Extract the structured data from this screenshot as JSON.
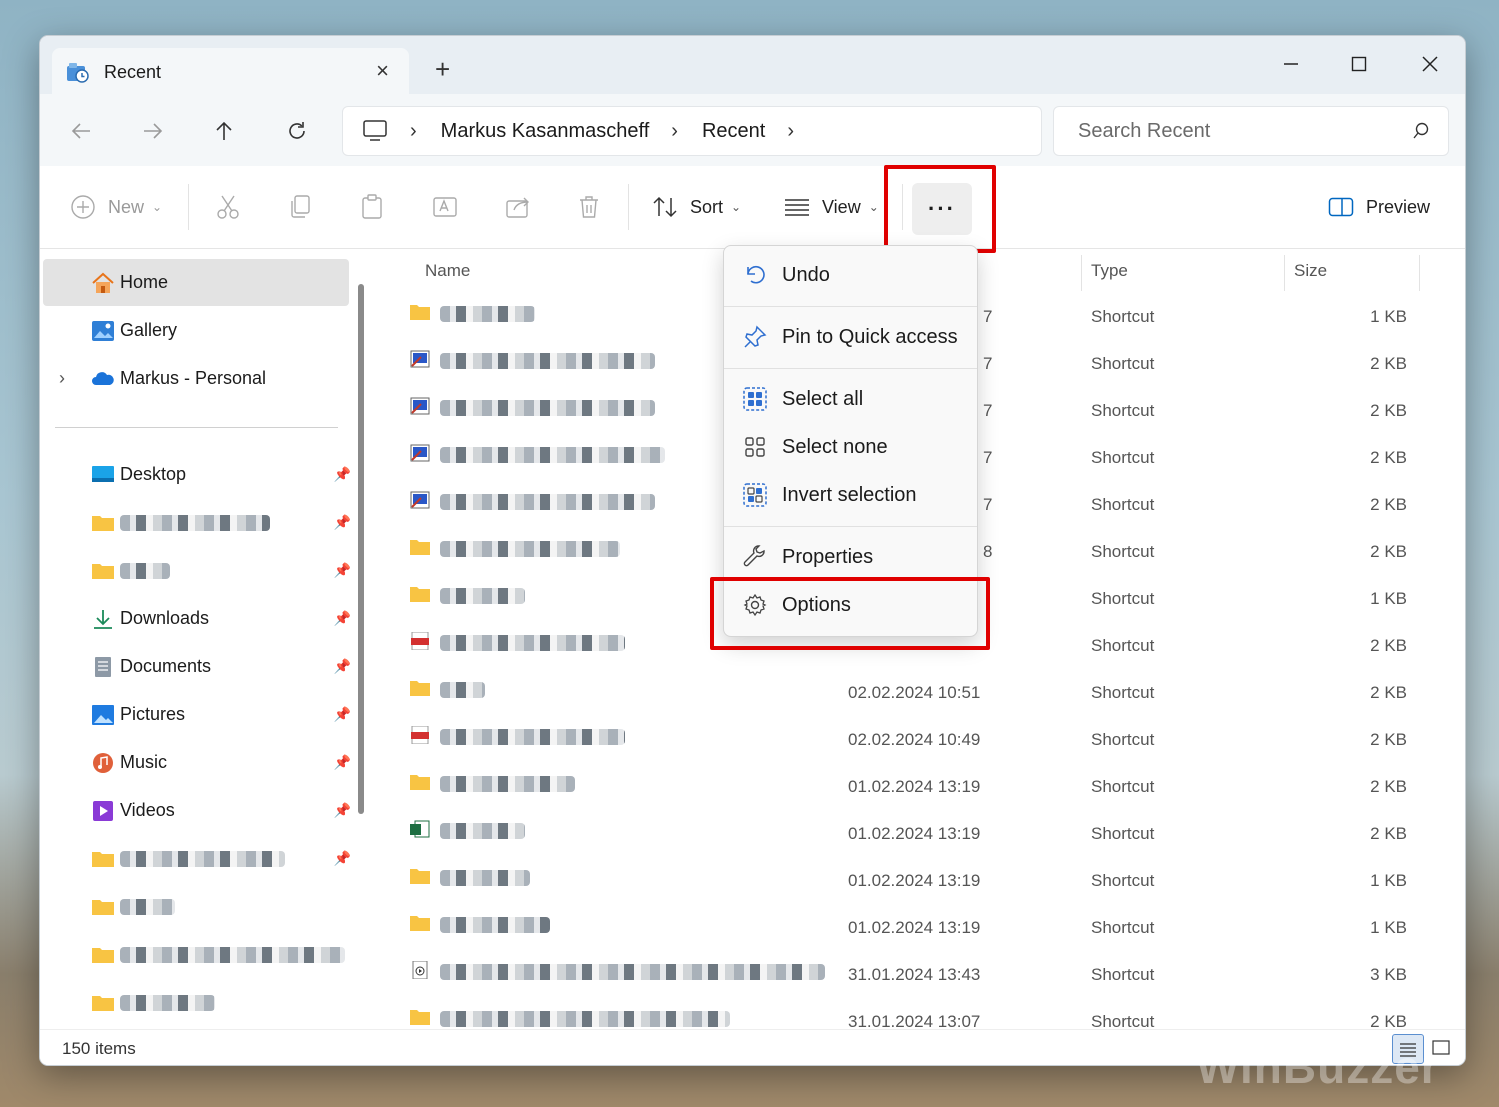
{
  "window": {
    "tab_title": "Recent",
    "new_tab_symbol": "+",
    "tab_close_symbol": "×"
  },
  "address": {
    "crumbs": [
      "Markus Kasanmascheff",
      "Recent"
    ],
    "search_placeholder": "Search Recent"
  },
  "toolbar": {
    "new_label": "New",
    "sort_label": "Sort",
    "view_label": "View",
    "more_label": "···",
    "preview_label": "Preview"
  },
  "sidebar": {
    "items": [
      {
        "label": "Home",
        "icon": "home-icon",
        "selected": true
      },
      {
        "label": "Gallery",
        "icon": "gallery-icon"
      },
      {
        "label": "Markus - Personal",
        "icon": "onedrive-cloud-icon",
        "expandable": true
      }
    ],
    "pinned": [
      {
        "label": "Desktop",
        "icon": "desktop-icon"
      },
      {
        "label": "",
        "icon": "folder-icon"
      },
      {
        "label": "",
        "icon": "folder-icon"
      },
      {
        "label": "Downloads",
        "icon": "download-icon"
      },
      {
        "label": "Documents",
        "icon": "documents-icon"
      },
      {
        "label": "Pictures",
        "icon": "pictures-icon"
      },
      {
        "label": "Music",
        "icon": "music-icon"
      },
      {
        "label": "Videos",
        "icon": "videos-icon"
      },
      {
        "label": "",
        "icon": "folder-icon"
      },
      {
        "label": "",
        "icon": "folder-icon"
      },
      {
        "label": "",
        "icon": "folder-icon"
      },
      {
        "label": "",
        "icon": "folder-icon"
      }
    ]
  },
  "columns": {
    "name": "Name",
    "type": "Type",
    "size": "Size"
  },
  "files": [
    {
      "icon": "folder",
      "date": "",
      "date_tail": "7",
      "type": "Shortcut",
      "size": "1 KB"
    },
    {
      "icon": "shortcut",
      "date": "",
      "date_tail": "7",
      "type": "Shortcut",
      "size": "2 KB"
    },
    {
      "icon": "shortcut",
      "date": "",
      "date_tail": "7",
      "type": "Shortcut",
      "size": "2 KB"
    },
    {
      "icon": "shortcut",
      "date": "",
      "date_tail": "7",
      "type": "Shortcut",
      "size": "2 KB"
    },
    {
      "icon": "shortcut",
      "date": "",
      "date_tail": "7",
      "type": "Shortcut",
      "size": "2 KB"
    },
    {
      "icon": "folder",
      "date": "",
      "date_tail": "8",
      "type": "Shortcut",
      "size": "2 KB"
    },
    {
      "icon": "folder",
      "date": "",
      "date_tail": "",
      "type": "Shortcut",
      "size": "1 KB"
    },
    {
      "icon": "pdf",
      "date": "",
      "date_tail": "",
      "type": "Shortcut",
      "size": "2 KB"
    },
    {
      "icon": "folder",
      "date": "02.02.2024 10:51",
      "type": "Shortcut",
      "size": "2 KB"
    },
    {
      "icon": "pdf",
      "date": "02.02.2024 10:49",
      "type": "Shortcut",
      "size": "2 KB"
    },
    {
      "icon": "folder",
      "date": "01.02.2024 13:19",
      "type": "Shortcut",
      "size": "2 KB"
    },
    {
      "icon": "excel",
      "date": "01.02.2024 13:19",
      "type": "Shortcut",
      "size": "2 KB"
    },
    {
      "icon": "folder",
      "date": "01.02.2024 13:19",
      "type": "Shortcut",
      "size": "1 KB"
    },
    {
      "icon": "folder",
      "date": "01.02.2024 13:19",
      "type": "Shortcut",
      "size": "1 KB"
    },
    {
      "icon": "video",
      "date": "31.01.2024 13:43",
      "type": "Shortcut",
      "size": "3 KB"
    },
    {
      "icon": "folder",
      "date": "31.01.2024 13:07",
      "type": "Shortcut",
      "size": "2 KB"
    }
  ],
  "menu": {
    "undo": "Undo",
    "pin": "Pin to Quick access",
    "select_all": "Select all",
    "select_none": "Select none",
    "invert": "Invert selection",
    "properties": "Properties",
    "options": "Options"
  },
  "status": {
    "count": "150 items"
  },
  "colors": {
    "accent": "#0067c0",
    "highlight": "#e00000",
    "folder": "#f8c443"
  }
}
